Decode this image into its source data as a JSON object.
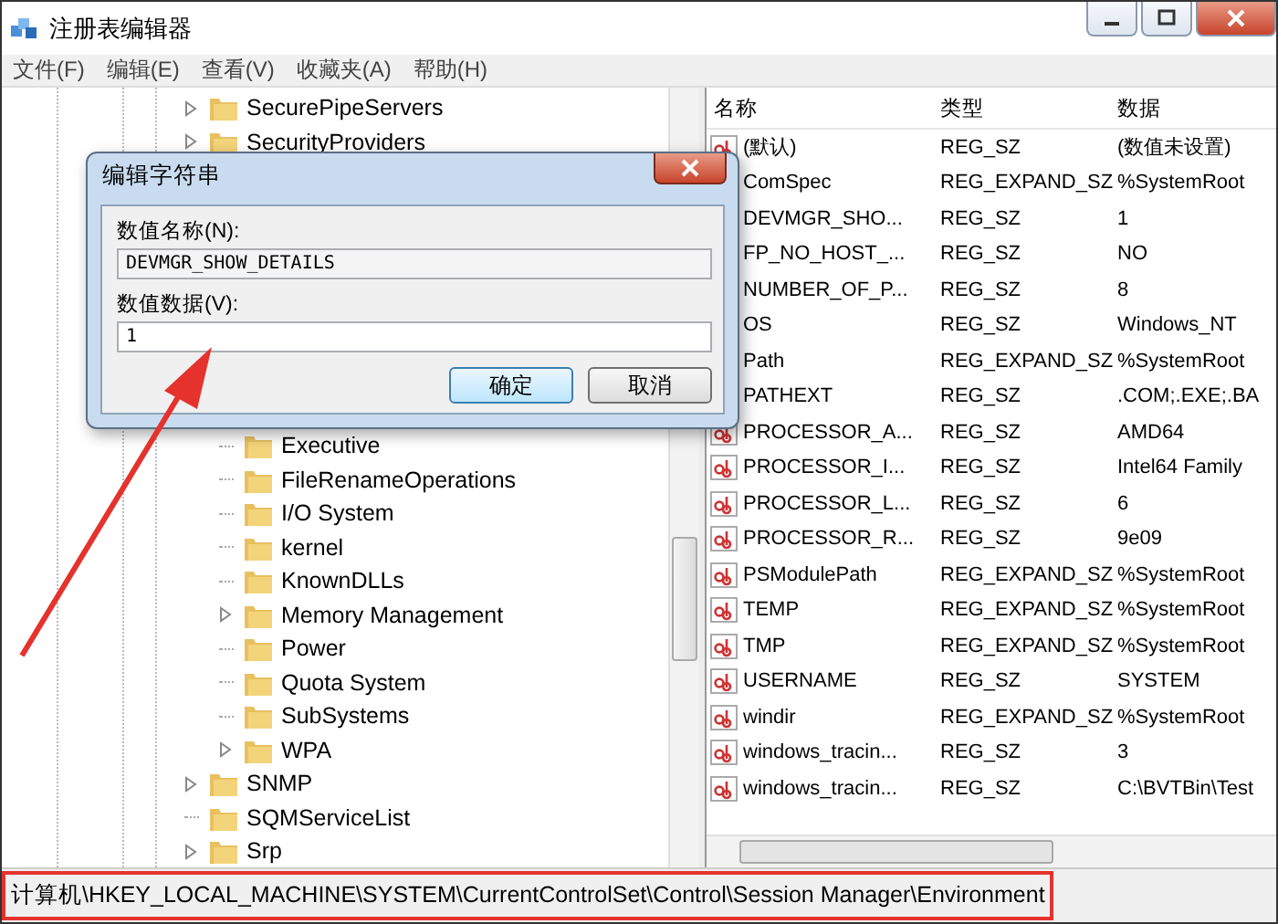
{
  "window": {
    "title": "注册表编辑器"
  },
  "menu": [
    "文件(F)",
    "编辑(E)",
    "查看(V)",
    "收藏夹(A)",
    "帮助(H)"
  ],
  "tree": [
    {
      "label": "SecurePipeServers",
      "has_children": true
    },
    {
      "label": "SecurityProviders",
      "has_children": true
    },
    {
      "children": [
        {
          "label": "Executive",
          "has_children": false
        },
        {
          "label": "FileRenameOperations",
          "has_children": false
        },
        {
          "label": "I/O System",
          "has_children": false
        },
        {
          "label": "kernel",
          "has_children": false
        },
        {
          "label": "KnownDLLs",
          "has_children": false
        },
        {
          "label": "Memory Management",
          "has_children": true
        },
        {
          "label": "Power",
          "has_children": false
        },
        {
          "label": "Quota System",
          "has_children": false
        },
        {
          "label": "SubSystems",
          "has_children": false
        },
        {
          "label": "WPA",
          "has_children": true
        }
      ]
    },
    {
      "label": "SNMP",
      "has_children": true
    },
    {
      "label": "SQMServiceList",
      "has_children": false
    },
    {
      "label": "Srp",
      "has_children": true
    }
  ],
  "list": {
    "columns": [
      "名称",
      "类型",
      "数据"
    ],
    "rows": [
      {
        "name": "(默认)",
        "type": "REG_SZ",
        "data": "(数值未设置)"
      },
      {
        "name": "ComSpec",
        "type": "REG_EXPAND_SZ",
        "data": "%SystemRoot"
      },
      {
        "name": "DEVMGR_SHO...",
        "type": "REG_SZ",
        "data": "1"
      },
      {
        "name": "FP_NO_HOST_...",
        "type": "REG_SZ",
        "data": "NO"
      },
      {
        "name": "NUMBER_OF_P...",
        "type": "REG_SZ",
        "data": "8"
      },
      {
        "name": "OS",
        "type": "REG_SZ",
        "data": "Windows_NT"
      },
      {
        "name": "Path",
        "type": "REG_EXPAND_SZ",
        "data": "%SystemRoot"
      },
      {
        "name": "PATHEXT",
        "type": "REG_SZ",
        "data": ".COM;.EXE;.BA"
      },
      {
        "name": "PROCESSOR_A...",
        "type": "REG_SZ",
        "data": "AMD64"
      },
      {
        "name": "PROCESSOR_I...",
        "type": "REG_SZ",
        "data": "Intel64 Family"
      },
      {
        "name": "PROCESSOR_L...",
        "type": "REG_SZ",
        "data": "6"
      },
      {
        "name": "PROCESSOR_R...",
        "type": "REG_SZ",
        "data": "9e09"
      },
      {
        "name": "PSModulePath",
        "type": "REG_EXPAND_SZ",
        "data": "%SystemRoot"
      },
      {
        "name": "TEMP",
        "type": "REG_EXPAND_SZ",
        "data": "%SystemRoot"
      },
      {
        "name": "TMP",
        "type": "REG_EXPAND_SZ",
        "data": "%SystemRoot"
      },
      {
        "name": "USERNAME",
        "type": "REG_SZ",
        "data": "SYSTEM"
      },
      {
        "name": "windir",
        "type": "REG_EXPAND_SZ",
        "data": "%SystemRoot"
      },
      {
        "name": "windows_tracin...",
        "type": "REG_SZ",
        "data": "3"
      },
      {
        "name": "windows_tracin...",
        "type": "REG_SZ",
        "data": "C:\\BVTBin\\Test"
      }
    ]
  },
  "dialog": {
    "title": "编辑字符串",
    "name_label": "数值名称(N):",
    "name_value": "DEVMGR_SHOW_DETAILS",
    "data_label": "数值数据(V):",
    "data_value": "1",
    "buttons": [
      {
        "label": "确定",
        "default": true
      },
      {
        "label": "取消",
        "default": false
      }
    ]
  },
  "status_bar": "计算机\\HKEY_LOCAL_MACHINE\\SYSTEM\\CurrentControlSet\\Control\\Session Manager\\Environment"
}
